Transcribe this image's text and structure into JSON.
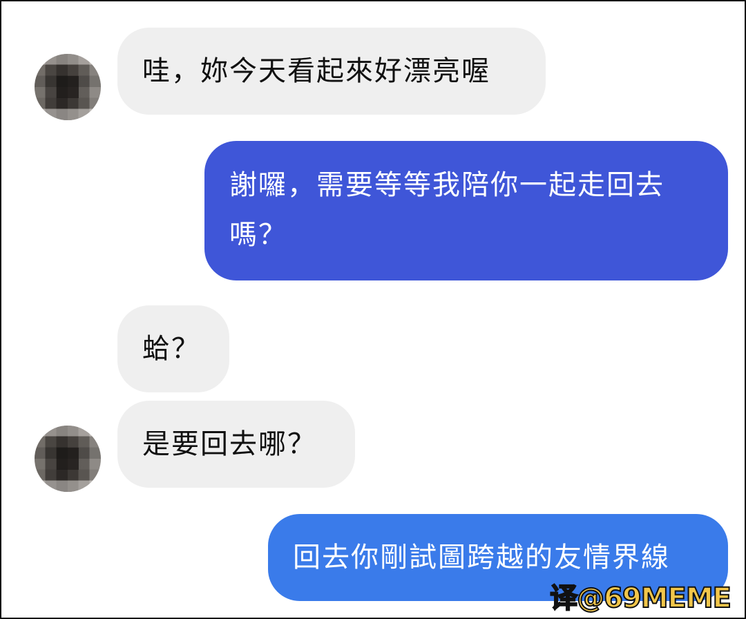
{
  "conversation": {
    "messages": [
      {
        "sender": "other",
        "text": "哇，妳今天看起來好漂亮喔"
      },
      {
        "sender": "me",
        "text": "謝囉，需要等等我陪你一起走回去嗎？"
      },
      {
        "sender": "other",
        "text": "蛤？"
      },
      {
        "sender": "other",
        "text": "是要回去哪？"
      },
      {
        "sender": "me",
        "text": "回去你剛試圖跨越的友情界線"
      }
    ]
  },
  "watermark": {
    "text": "译@69MEME"
  },
  "colors": {
    "incoming_bubble": "#efefef",
    "outgoing_bubble_1": "#3f56d8",
    "outgoing_bubble_2": "#3a7bea",
    "watermark": "#f2c64a"
  }
}
